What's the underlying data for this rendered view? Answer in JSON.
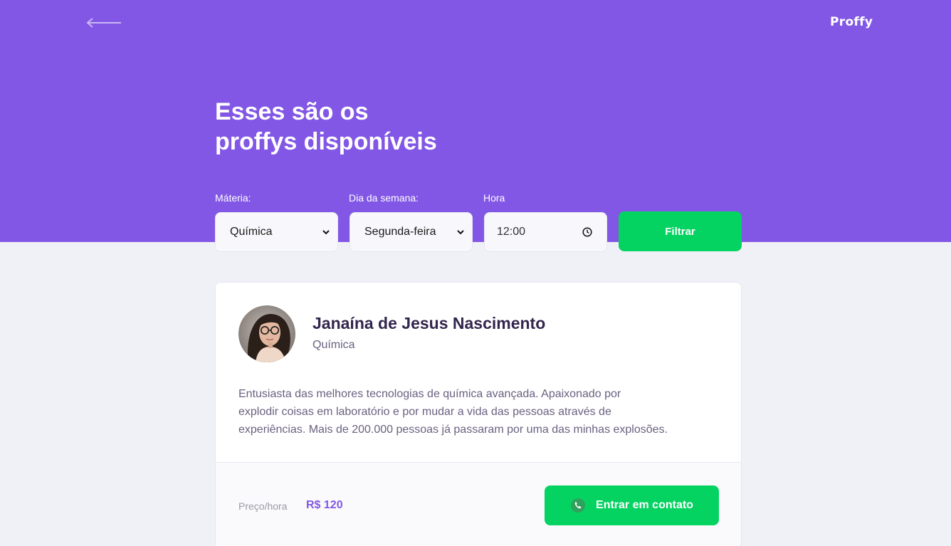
{
  "header": {
    "back_icon": "arrow-left-icon",
    "logo": "Proffy",
    "title_line1": "Esses são os",
    "title_line2": "proffys disponíveis"
  },
  "filters": {
    "subject": {
      "label": "Máteria:",
      "value": "Química"
    },
    "weekday": {
      "label": "Dia da semana:",
      "value": "Segunda-feira"
    },
    "time": {
      "label": "Hora",
      "value": "12:00"
    },
    "submit_label": "Filtrar"
  },
  "teacher": {
    "name": "Janaína de Jesus Nascimento",
    "subject": "Química",
    "bio_line1": "Entusiasta das melhores tecnologias de química avançada. Apaixonado por",
    "bio_line2": "explodir coisas em laboratório e por mudar a vida das pessoas através de",
    "bio_line3": "experiências. Mais de 200.000 pessoas já passaram por uma das minhas explosões.",
    "price_label": "Preço/hora",
    "price_value": "R$ 120",
    "contact_label": "Entrar em contato"
  },
  "colors": {
    "primary": "#8257E5",
    "success": "#04D361",
    "background": "#F0F0F7"
  }
}
